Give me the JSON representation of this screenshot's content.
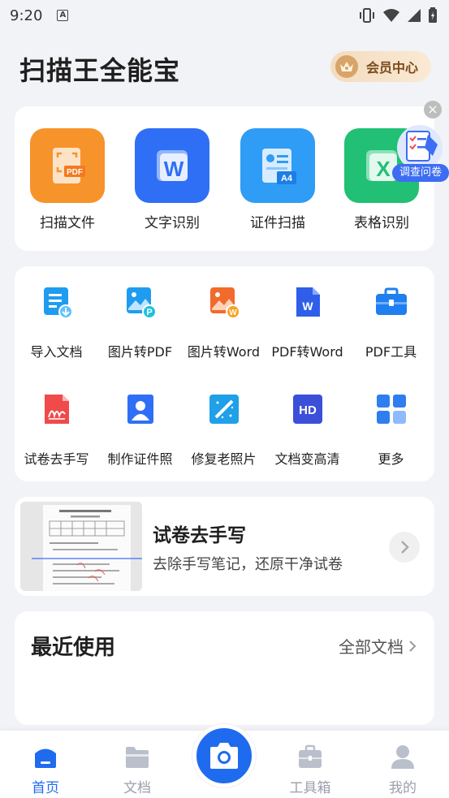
{
  "status_bar": {
    "time": "9:20",
    "notification_icon": "A"
  },
  "header": {
    "title": "扫描王全能宝",
    "vip_label": "会员中心"
  },
  "main_tools": [
    {
      "label": "扫描文件",
      "icon": "scan-pdf-icon",
      "badge": "PDF",
      "color": "#f7932b"
    },
    {
      "label": "文字识别",
      "icon": "ocr-word-icon",
      "badge": "W",
      "color": "#2f6ff5"
    },
    {
      "label": "证件扫描",
      "icon": "id-scan-icon",
      "badge": "A4",
      "color": "#2f9cf5"
    },
    {
      "label": "表格识别",
      "icon": "excel-icon",
      "badge": "X",
      "color": "#22c074"
    }
  ],
  "survey": {
    "label": "调查问卷",
    "close": "×"
  },
  "tools": [
    {
      "label": "导入文档",
      "icon": "import-doc-icon"
    },
    {
      "label": "图片转PDF",
      "icon": "image-to-pdf-icon",
      "badge": "P"
    },
    {
      "label": "图片转Word",
      "icon": "image-to-word-icon",
      "badge": "W"
    },
    {
      "label": "PDF转Word",
      "icon": "pdf-to-word-icon",
      "badge": "W"
    },
    {
      "label": "PDF工具",
      "icon": "pdf-tools-icon"
    },
    {
      "label": "试卷去手写",
      "icon": "remove-handwriting-icon"
    },
    {
      "label": "制作证件照",
      "icon": "id-photo-icon"
    },
    {
      "label": "修复老照片",
      "icon": "restore-photo-icon"
    },
    {
      "label": "文档变高清",
      "icon": "hd-doc-icon",
      "badge": "HD"
    },
    {
      "label": "更多",
      "icon": "more-grid-icon"
    }
  ],
  "banner": {
    "title": "试卷去手写",
    "subtitle": "去除手写笔记，还原干净试卷"
  },
  "recent": {
    "title": "最近使用",
    "all_label": "全部文档"
  },
  "tabbar": {
    "tabs": [
      {
        "label": "首页",
        "icon": "home-icon",
        "active": true
      },
      {
        "label": "文档",
        "icon": "folder-icon",
        "active": false
      },
      {
        "label": "工具箱",
        "icon": "toolbox-icon",
        "active": false
      },
      {
        "label": "我的",
        "icon": "profile-icon",
        "active": false
      }
    ]
  },
  "colors": {
    "accent": "#1f6bf0",
    "inactive": "#9aa0aa"
  }
}
